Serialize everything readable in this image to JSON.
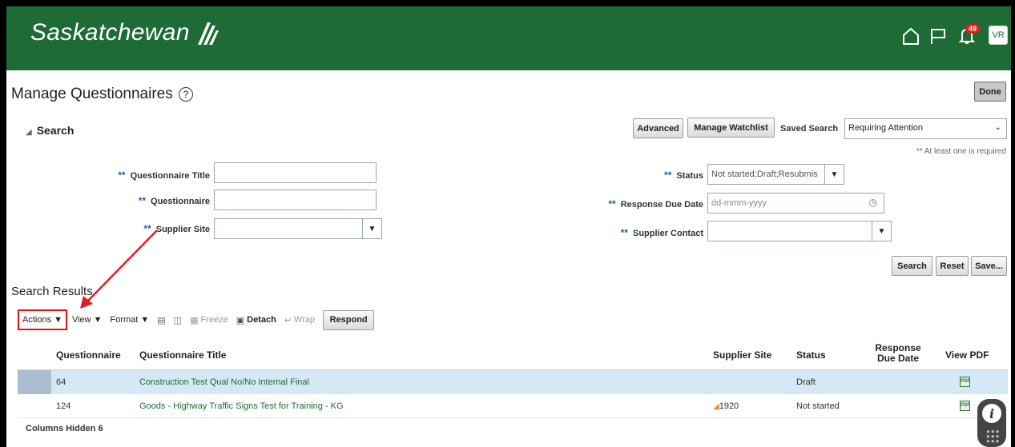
{
  "header": {
    "brand": "Saskatchewan",
    "notification_count": "49",
    "avatar_initials": "VR",
    "color": "#1e6b35"
  },
  "page": {
    "title": "Manage Questionnaires",
    "done_label": "Done"
  },
  "search": {
    "toggle_label": "Search",
    "advanced_label": "Advanced",
    "watchlist_label": "Manage Watchlist",
    "saved_search_label": "Saved Search",
    "saved_search_value": "Requiring Attention",
    "required_note": "** At least one is required",
    "required_marker": "**",
    "fields": {
      "questionnaire_title": {
        "label": "Questionnaire Title",
        "value": ""
      },
      "questionnaire": {
        "label": "Questionnaire",
        "value": ""
      },
      "supplier_site": {
        "label": "Supplier Site",
        "value": ""
      },
      "status": {
        "label": "Status",
        "value": "Not started;Draft;Resubmis"
      },
      "response_due_date": {
        "label": "Response Due Date",
        "placeholder": "dd-mmm-yyyy"
      },
      "supplier_contact": {
        "label": "Supplier Contact",
        "value": ""
      }
    },
    "search_label": "Search",
    "reset_label": "Reset",
    "save_label": "Save..."
  },
  "results": {
    "title": "Search Results",
    "toolbar": {
      "actions": "Actions",
      "view": "View",
      "format": "Format",
      "freeze": "Freeze",
      "detach": "Detach",
      "wrap": "Wrap",
      "respond": "Respond"
    },
    "columns": {
      "questionnaire": "Questionnaire",
      "title": "Questionnaire Title",
      "supplier_site": "Supplier Site",
      "status": "Status",
      "response_due_date": "Response Due Date",
      "view_pdf": "View PDF"
    },
    "rows": [
      {
        "questionnaire": "64",
        "title": "Construction Test Qual No/No Internal Final",
        "supplier_site": "",
        "status": "Draft",
        "response_due_date": ""
      },
      {
        "questionnaire": "124",
        "title": "Goods - Highway Traffic Signs Test for Training - KG",
        "supplier_site": "1920",
        "status": "Not started",
        "response_due_date": ""
      }
    ],
    "columns_hidden": "Columns Hidden 6"
  },
  "icons": {
    "pdf": "PDF"
  }
}
